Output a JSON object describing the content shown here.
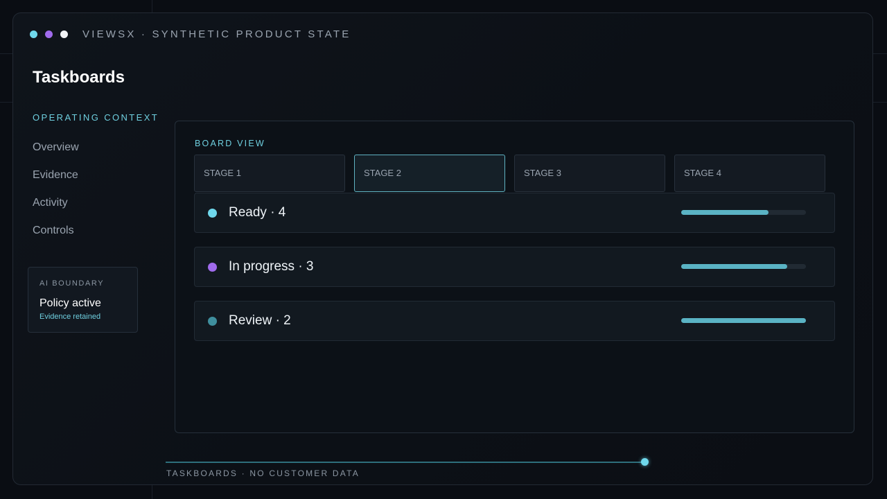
{
  "window": {
    "title": "VIEWSX · SYNTHETIC PRODUCT STATE",
    "dots": [
      {
        "name": "cyan-dot",
        "color": "#6fd8ec"
      },
      {
        "name": "purple-dot",
        "color": "#a06bec"
      },
      {
        "name": "white-dot",
        "color": "#f2f4f7"
      }
    ]
  },
  "page": {
    "title": "Taskboards"
  },
  "sidebar": {
    "section_label": "OPERATING CONTEXT",
    "items": [
      {
        "label": "Overview"
      },
      {
        "label": "Evidence"
      },
      {
        "label": "Activity"
      },
      {
        "label": "Controls"
      }
    ],
    "ai_card": {
      "label": "AI BOUNDARY",
      "status": "Policy active",
      "detail": "Evidence retained"
    }
  },
  "board": {
    "label": "BOARD VIEW",
    "tabs": [
      {
        "label": "STAGE 1",
        "active": false
      },
      {
        "label": "STAGE 2",
        "active": true
      },
      {
        "label": "STAGE 3",
        "active": false
      },
      {
        "label": "STAGE 4",
        "active": false
      }
    ],
    "rows": [
      {
        "label": "Ready · 4",
        "dot_color": "#6fd8ec",
        "progress": 0.7
      },
      {
        "label": "In progress · 3",
        "dot_color": "#a06bec",
        "progress": 0.85
      },
      {
        "label": "Review · 2",
        "dot_color": "#3f8f9e",
        "progress": 1.0
      }
    ]
  },
  "footer": {
    "text": "TASKBOARDS · NO CUSTOMER DATA",
    "slider_value": 1.0
  },
  "colors": {
    "accent": "#6fd0e0",
    "progress": "#5ab3c4"
  }
}
